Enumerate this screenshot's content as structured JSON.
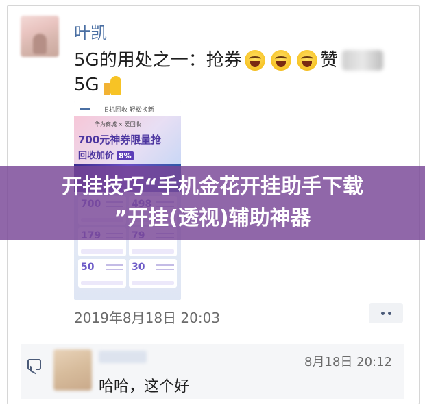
{
  "post": {
    "author": "叶凯",
    "line1_prefix": "5G的用处之一：抢券",
    "line1_suffix": "赞",
    "line2": "5G",
    "timestamp": "2019年8月18日 20:03"
  },
  "promo_image": {
    "top_text": "旧机回收 轻松换新",
    "brand": "华为商城 × 爱回收",
    "headline": "700元神券限量抢",
    "subline": "回收加价",
    "percent": "8%",
    "tiles": [
      "700",
      "498",
      "179",
      "79",
      "50",
      "30"
    ]
  },
  "comment": {
    "time": "8月18日 20:12",
    "text": "哈哈，这个好"
  },
  "overlay": {
    "line1": "开挂技巧“手机金花开挂助手下载",
    "line2": "”开挂(透视)辅助神器"
  },
  "icons": [
    "avatar",
    "laugh-emoji-icon",
    "thumbs-up-icon",
    "more-dots-icon",
    "comment-icon"
  ]
}
